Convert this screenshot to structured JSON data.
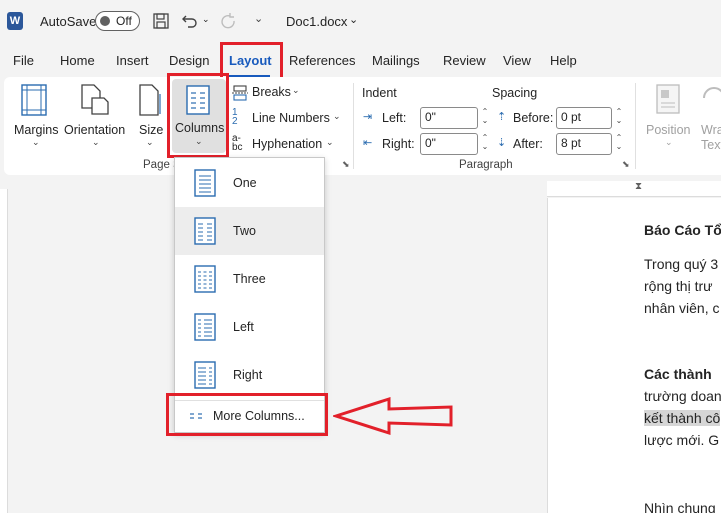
{
  "titlebar": {
    "autosave_label": "AutoSave",
    "autosave_state": "Off",
    "doc_name": "Doc1.docx"
  },
  "tabs": [
    "File",
    "Home",
    "Insert",
    "Design",
    "Layout",
    "References",
    "Mailings",
    "Review",
    "View",
    "Help"
  ],
  "active_tab": "Layout",
  "ribbon": {
    "page_setup": {
      "margins": "Margins",
      "orientation": "Orientation",
      "size": "Size",
      "columns": "Columns",
      "breaks": "Breaks",
      "line_numbers": "Line Numbers",
      "hyphenation": "Hyphenation",
      "group_label": "Page S"
    },
    "paragraph": {
      "indent_label": "Indent",
      "spacing_label": "Spacing",
      "left_label": "Left:",
      "left_value": "0\"",
      "right_label": "Right:",
      "right_value": "0\"",
      "before_label": "Before:",
      "before_value": "0 pt",
      "after_label": "After:",
      "after_value": "8 pt",
      "group_label": "Paragraph"
    },
    "arrange": {
      "position": "Position",
      "wrap_text_1": "Wra",
      "wrap_text_2": "Text"
    }
  },
  "columns_menu": {
    "items": [
      "One",
      "Two",
      "Three",
      "Left",
      "Right"
    ],
    "selected": "Two",
    "more": "More Columns..."
  },
  "document": {
    "line1": "Báo Cáo Tổ",
    "line2": "Trong quý 3",
    "line3": "rộng thị trư",
    "line4": "nhân viên, c",
    "line5": "Các thành",
    "line6": "trường doan",
    "line7": "kết thành cô",
    "line8": "lược mới. G",
    "line9": "Nhìn chung"
  },
  "colors": {
    "accent_red": "#e2202a",
    "word_blue": "#2b579a"
  }
}
